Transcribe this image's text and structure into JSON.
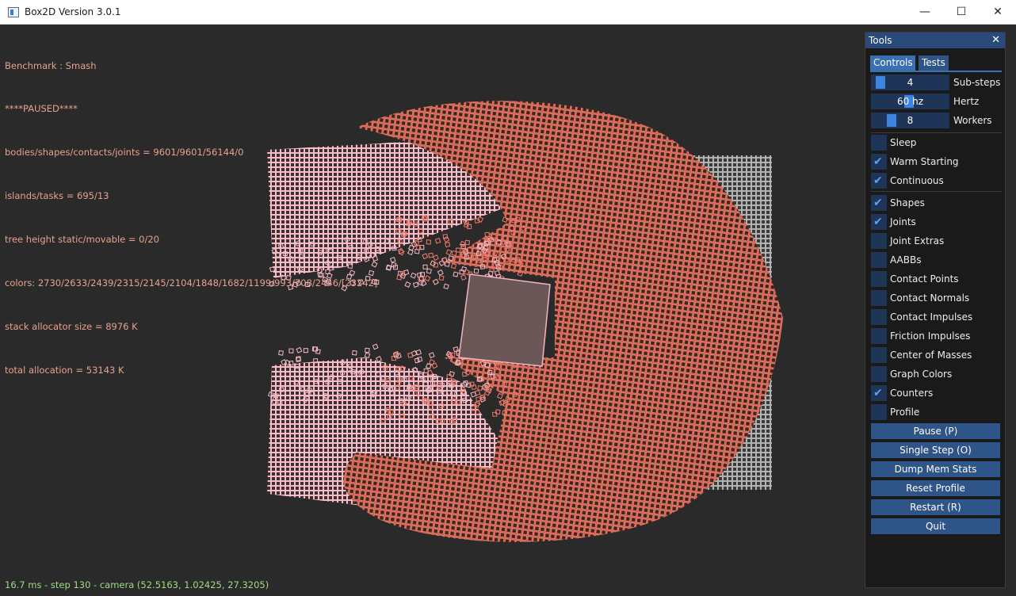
{
  "window": {
    "title": "Box2D Version 3.0.1",
    "minimize_glyph": "—",
    "maximize_glyph": "☐",
    "close_glyph": "✕"
  },
  "stats": {
    "lines": [
      "Benchmark : Smash",
      "****PAUSED****",
      "bodies/shapes/contacts/joints = 9601/9601/56144/0",
      "islands/tasks = 695/13",
      "tree height static/movable = 0/20",
      "colors: 2730/2633/2439/2315/2145/2104/1848/1682/1199/993/708/2446/[23242]",
      "stack allocator size = 8976 K",
      "total allocation = 53143 K"
    ],
    "footer": "16.7 ms - step 130 - camera (52.5163, 1.02425, 27.3205)"
  },
  "tools": {
    "title": "Tools",
    "close_glyph": "✕",
    "tabs": [
      "Controls",
      "Tests"
    ],
    "sliders": [
      {
        "value": "4",
        "label": "Sub-steps"
      },
      {
        "value": "60 hz",
        "label": "Hertz"
      },
      {
        "value": "8",
        "label": "Workers"
      }
    ],
    "checkboxes_group1": [
      {
        "label": "Sleep",
        "checked": false
      },
      {
        "label": "Warm Starting",
        "checked": true
      },
      {
        "label": "Continuous",
        "checked": true
      }
    ],
    "checkboxes_group2": [
      {
        "label": "Shapes",
        "checked": true
      },
      {
        "label": "Joints",
        "checked": true
      },
      {
        "label": "Joint Extras",
        "checked": false
      },
      {
        "label": "AABBs",
        "checked": false
      },
      {
        "label": "Contact Points",
        "checked": false
      },
      {
        "label": "Contact Normals",
        "checked": false
      },
      {
        "label": "Contact Impulses",
        "checked": false
      },
      {
        "label": "Friction Impulses",
        "checked": false
      },
      {
        "label": "Center of Masses",
        "checked": false
      },
      {
        "label": "Graph Colors",
        "checked": false
      },
      {
        "label": "Counters",
        "checked": true
      },
      {
        "label": "Profile",
        "checked": false
      }
    ],
    "buttons": [
      "Pause (P)",
      "Single Step (O)",
      "Dump Mem Stats",
      "Reset Profile",
      "Restart (R)",
      "Quit"
    ],
    "check_glyph": "✔"
  },
  "colors": {
    "body_awake": "#f07b6a",
    "body_pink": "#f5b8c4",
    "static_grid": "#cfcfcf",
    "projectile": "#6a5558"
  }
}
